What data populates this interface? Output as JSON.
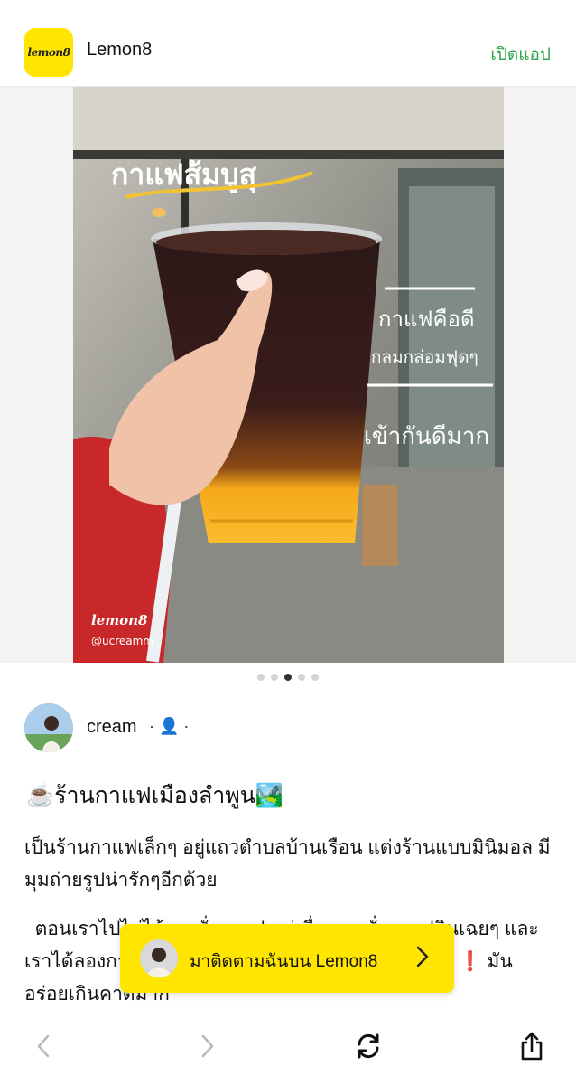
{
  "header": {
    "app_name": "Lemon8",
    "logo_text": "lemon8",
    "open_app": "เปิดแอป"
  },
  "photo": {
    "overlay_title": "กาแฟส้มบูสุ",
    "overlay_line1": "กาแฟคือดี",
    "overlay_line2": "กลมกล่อมฟุดๆ",
    "overlay_line3": "เข้ากันดีมาก",
    "watermark_logo": "lemon8",
    "watermark_handle": "@ucreamm"
  },
  "carousel": {
    "count": 5,
    "active_index": 2
  },
  "author": {
    "name": "cream",
    "meta": "· 👤 ·"
  },
  "post": {
    "title": "☕ร้านกาแฟเมืองลำพูน🏞️",
    "paragraph1": "เป็นร้านกาแฟเล็กๆ อยู่แถวตำบลบ้านเรือน แต่งร้านแบบมินิมอล มีมุมถ่ายรูปน่ารักๆอีกด้วย",
    "paragraph2": "  ตอนเราไปไม่ได้ลองสั่งกาแฟ แต่เพื่อนเราสั่งกาแฟกินเฉยๆ และเราได้ลองกาแฟส้มดู แต่พอได้ลองสั่งกิน แกกกกกก ❗️❗️ มันอร่อยเกินคาดมาก"
  },
  "follow_banner": {
    "text": "มาติดตามฉันบน Lemon8"
  },
  "colors": {
    "brand_yellow": "#ffe500",
    "open_app_green": "#2ea44f"
  },
  "icons": {
    "back": "chevron-left-icon",
    "forward": "chevron-right-icon",
    "refresh": "refresh-icon",
    "share": "share-icon"
  }
}
